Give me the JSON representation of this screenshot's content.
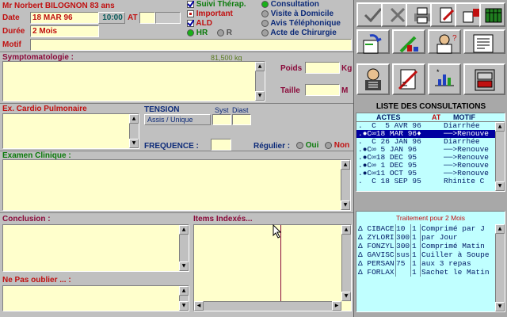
{
  "patient": {
    "name": "Mr Norbert BILOGNON 83 ans"
  },
  "header": {
    "date_label": "Date",
    "date_value": "18 MAR 96",
    "time_value": "10:00",
    "at_label": "AT",
    "duree_label": "Durée",
    "duree_value": "2 Mois",
    "motif_label": "Motif"
  },
  "flags": {
    "suivi_therap": "Suivi Thérap.",
    "important": "Important",
    "ald": "ALD",
    "hr": "HR",
    "r": "R"
  },
  "visit_types": [
    "Consultation",
    "Visite à Domicile",
    "Avis Téléphonique",
    "Acte de Chirurgie"
  ],
  "sections": {
    "symptomatologie": "Symptomatologie :",
    "weight_display": "81,500 kg",
    "poids": "Poids",
    "poids_unit": "Kg",
    "taille": "Taille",
    "taille_unit": "M",
    "cardio": "Ex. Cardio Pulmonaire",
    "tension": "TENSION",
    "syst": "Syst",
    "diast": "Diast",
    "tension_mode": "Assis / Unique",
    "frequence": "FREQUENCE :",
    "regulier": "Régulier :",
    "oui": "Oui",
    "non": "Non",
    "examen": "Examen Clinique :",
    "conclusion": "Conclusion :",
    "items": "Items Indexés...",
    "nepasoublier": "Ne Pas oublier ... :"
  },
  "consultations": {
    "title": "LISTE DES CONSULTATIONS",
    "col_actes": "ACTES",
    "col_at": "AT",
    "col_motif": "MOTIF",
    "rows": [
      {
        "acte": ".  C  5 AVR 96",
        "at": "",
        "motif": "Diarrhée"
      },
      {
        "acte": ".●C∞18 MAR 96♦",
        "at": "",
        "motif": "──>Renouve"
      },
      {
        "acte": ".  C 26 JAN 96",
        "at": "",
        "motif": "Diarrhée"
      },
      {
        "acte": ".●C∞ 5 JAN 96",
        "at": "",
        "motif": "──>Renouve"
      },
      {
        "acte": ".●C∞18 DEC 95",
        "at": "",
        "motif": "──>Renouve"
      },
      {
        "acte": ".●C∞ 1 DEC 95",
        "at": "",
        "motif": "──>Renouve"
      },
      {
        "acte": ".●C∞11 OCT 95",
        "at": "",
        "motif": "──>Renouve"
      },
      {
        "acte": ".  C 18 SEP 95",
        "at": "",
        "motif": "Rhinite C"
      }
    ]
  },
  "traitement": {
    "title": "Traitement pour 2 Mois",
    "rows": [
      {
        "drug": "Δ CIBACE",
        "qty": "10",
        "n": "1",
        "posology": "Comprimé par J"
      },
      {
        "drug": "Δ ZYLORI",
        "qty": "300",
        "n": "1",
        "posology": "par Jour"
      },
      {
        "drug": "Δ FONZYL",
        "qty": "300",
        "n": "1",
        "posology": "Comprimé Matin"
      },
      {
        "drug": "Δ GAVISC",
        "qty": "sus",
        "n": "1",
        "posology": "Cuiller à Soupe"
      },
      {
        "drug": "Δ PERSAN",
        "qty": "75",
        "n": "1",
        "posology": "aux 3 repas"
      },
      {
        "drug": "Δ FORLAX",
        "qty": "",
        "n": "1",
        "posology": "Sachet le Matin"
      }
    ]
  },
  "toolbar": [
    "validate-check-icon",
    "cancel-x-icon",
    "print-icon",
    "edit-document-icon",
    "delete-red-icon",
    "calendar-icon",
    "patient-record-icon",
    "prescription-pen-icon",
    "doctor-card-icon",
    "letter-icon",
    "xray-icon",
    "measure-chart-icon",
    "stats-icon",
    "archive-cabinet-icon"
  ],
  "colors": {
    "field_bg": "#ffffcc",
    "list_bg": "#c0ffff",
    "selected": "#0000a0",
    "accent_green": "#18b018",
    "accent_red": "#c01010"
  }
}
